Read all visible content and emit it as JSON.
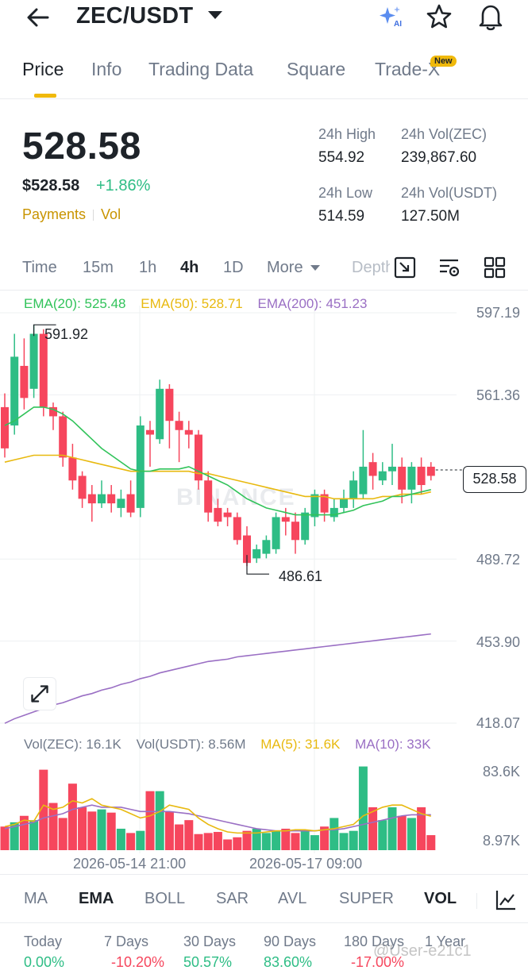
{
  "header": {
    "pair": "ZEC/USDT",
    "ai_label": "AI"
  },
  "tabs": [
    {
      "label": "Price"
    },
    {
      "label": "Info"
    },
    {
      "label": "Trading Data"
    },
    {
      "label": "Square"
    },
    {
      "label": "Trade-X"
    }
  ],
  "new_badge": "New",
  "summary": {
    "price": "528.58",
    "usd_price": "$528.58",
    "change": "+1.86%",
    "link_payments": "Payments",
    "link_vol": "Vol",
    "high_label": "24h High",
    "high_value": "554.92",
    "vol_zec_label": "24h Vol(ZEC)",
    "vol_zec_value": "239,867.60",
    "low_label": "24h Low",
    "low_value": "514.59",
    "vol_usdt_label": "24h Vol(USDT)",
    "vol_usdt_value": "127.50M"
  },
  "intervals": [
    {
      "label": "Time"
    },
    {
      "label": "15m"
    },
    {
      "label": "1h"
    },
    {
      "label": "4h"
    },
    {
      "label": "1D"
    },
    {
      "label": "More"
    },
    {
      "label": "Depth"
    }
  ],
  "ema_legend": {
    "ema20": "EMA(20): 525.48",
    "ema50": "EMA(50): 528.71",
    "ema200": "EMA(200): 451.23"
  },
  "colors": {
    "up": "#2ebd85",
    "down": "#f6465d",
    "ema20": "#31c35a",
    "ema50": "#e8b90f",
    "ema200": "#9a6fc4",
    "accent": "#f0b90b"
  },
  "price_axis": [
    "597.19",
    "561.36",
    "528.58",
    "489.72",
    "453.90",
    "418.07"
  ],
  "current_price_label": "528.58",
  "high_marker": "591.92",
  "low_marker": "486.61",
  "watermark": "BINANCE",
  "volume_legend": {
    "vol_zec": "Vol(ZEC): 16.1K",
    "vol_usdt": "Vol(USDT): 8.56M",
    "ma5": "MA(5): 31.6K",
    "ma10": "MA(10): 33K"
  },
  "volume_axis": [
    "83.6K",
    "8.97K"
  ],
  "date_labels": [
    "2026-05-14 21:00",
    "2026-05-17 09:00"
  ],
  "indicators": [
    {
      "label": "MA"
    },
    {
      "label": "EMA"
    },
    {
      "label": "BOLL"
    },
    {
      "label": "SAR"
    },
    {
      "label": "AVL"
    },
    {
      "label": "SUPER"
    },
    {
      "label": "VOL"
    }
  ],
  "performance": [
    {
      "label": "Today",
      "value": "0.00%"
    },
    {
      "label": "7 Days",
      "value": "-10.20%"
    },
    {
      "label": "30 Days",
      "value": "50.57%"
    },
    {
      "label": "90 Days",
      "value": "83.60%"
    },
    {
      "label": "180 Days",
      "value": "-17.00%"
    },
    {
      "label": "1 Year",
      "value": ""
    }
  ],
  "user_watermark": "@User-e21c1",
  "chart_data": {
    "type": "candlestick",
    "interval": "4h",
    "y_range": [
      418.07,
      597.19
    ],
    "candles": [
      {
        "o": 556,
        "h": 562,
        "c": 538,
        "l": 534
      },
      {
        "o": 548,
        "h": 588,
        "c": 578,
        "l": 544
      },
      {
        "o": 574,
        "h": 586,
        "c": 560,
        "l": 555
      },
      {
        "o": 564,
        "h": 591.92,
        "c": 588,
        "l": 560
      },
      {
        "o": 588,
        "h": 590,
        "c": 556,
        "l": 552
      },
      {
        "o": 556,
        "h": 558,
        "c": 552,
        "l": 546
      },
      {
        "o": 552,
        "h": 554,
        "c": 534,
        "l": 530
      },
      {
        "o": 534,
        "h": 540,
        "c": 524,
        "l": 520
      },
      {
        "o": 526,
        "h": 528,
        "c": 516,
        "l": 512
      },
      {
        "o": 518,
        "h": 522,
        "c": 514,
        "l": 506
      },
      {
        "o": 514,
        "h": 524,
        "c": 518,
        "l": 512
      },
      {
        "o": 518,
        "h": 522,
        "c": 514,
        "l": 510
      },
      {
        "o": 512,
        "h": 520,
        "c": 516,
        "l": 508
      },
      {
        "o": 518,
        "h": 524,
        "c": 510,
        "l": 508
      },
      {
        "o": 512,
        "h": 552,
        "c": 548,
        "l": 508
      },
      {
        "o": 546,
        "h": 550,
        "c": 544,
        "l": 530
      },
      {
        "o": 542,
        "h": 568,
        "c": 564,
        "l": 540
      },
      {
        "o": 564,
        "h": 566,
        "c": 550,
        "l": 538
      },
      {
        "o": 550,
        "h": 554,
        "c": 546,
        "l": 532
      },
      {
        "o": 546,
        "h": 550,
        "c": 544,
        "l": 538
      },
      {
        "o": 544,
        "h": 546,
        "c": 524,
        "l": 520
      },
      {
        "o": 524,
        "h": 528,
        "c": 510,
        "l": 506
      },
      {
        "o": 512,
        "h": 516,
        "c": 506,
        "l": 504
      },
      {
        "o": 510,
        "h": 512,
        "c": 508,
        "l": 504
      },
      {
        "o": 508,
        "h": 510,
        "c": 498,
        "l": 496
      },
      {
        "o": 500,
        "h": 504,
        "c": 488,
        "l": 486.61
      },
      {
        "o": 490,
        "h": 496,
        "c": 494,
        "l": 488
      },
      {
        "o": 492,
        "h": 500,
        "c": 498,
        "l": 490
      },
      {
        "o": 494,
        "h": 510,
        "c": 508,
        "l": 492
      },
      {
        "o": 508,
        "h": 512,
        "c": 506,
        "l": 500
      },
      {
        "o": 506,
        "h": 510,
        "c": 498,
        "l": 492
      },
      {
        "o": 498,
        "h": 512,
        "c": 510,
        "l": 496
      },
      {
        "o": 508,
        "h": 520,
        "c": 518,
        "l": 504
      },
      {
        "o": 518,
        "h": 520,
        "c": 510,
        "l": 506
      },
      {
        "o": 508,
        "h": 516,
        "c": 512,
        "l": 506
      },
      {
        "o": 512,
        "h": 520,
        "c": 516,
        "l": 510
      },
      {
        "o": 516,
        "h": 528,
        "c": 524,
        "l": 512
      },
      {
        "o": 518,
        "h": 546,
        "c": 530,
        "l": 516
      },
      {
        "o": 532,
        "h": 536,
        "c": 526,
        "l": 520
      },
      {
        "o": 524,
        "h": 532,
        "c": 528,
        "l": 522
      },
      {
        "o": 528,
        "h": 540,
        "c": 530,
        "l": 522
      },
      {
        "o": 530,
        "h": 534,
        "c": 520,
        "l": 514
      },
      {
        "o": 520,
        "h": 532,
        "c": 530,
        "l": 514
      },
      {
        "o": 530,
        "h": 534,
        "c": 522,
        "l": 518
      },
      {
        "o": 530,
        "h": 532,
        "c": 526,
        "l": 524
      }
    ],
    "ema20": [
      548,
      550,
      553,
      556,
      556,
      555,
      553,
      550,
      546,
      542,
      538,
      535,
      532,
      529,
      528,
      528,
      529,
      529,
      529,
      530,
      528,
      526,
      524,
      522,
      519,
      516,
      514,
      512,
      511,
      510,
      509,
      509,
      509,
      509,
      509,
      510,
      511,
      513,
      514,
      515,
      517,
      517,
      518,
      519,
      520
    ],
    "ema50": [
      532,
      533,
      534,
      535,
      535,
      535,
      535,
      534,
      533,
      532,
      531,
      530,
      529,
      528,
      528,
      528,
      528,
      528,
      528,
      528,
      527,
      527,
      526,
      525,
      524,
      523,
      522,
      521,
      520,
      519,
      518,
      517,
      517,
      517,
      516,
      516,
      516,
      516,
      516,
      517,
      517,
      518,
      518,
      518,
      519
    ],
    "ema200": [
      418,
      420,
      421.5,
      423,
      424.5,
      426,
      427,
      428.5,
      430,
      431,
      432.5,
      433.5,
      435,
      436,
      437.5,
      438.5,
      440,
      441,
      442,
      443,
      444,
      445,
      445.5,
      446,
      447,
      447.5,
      448,
      448.5,
      449,
      449.5,
      450,
      450.5,
      451,
      451.5,
      452,
      452.5,
      453,
      453.5,
      454,
      454.5,
      455,
      455.5,
      456,
      456.5,
      457
    ],
    "volume": [
      22,
      26,
      32,
      28,
      75,
      44,
      30,
      62,
      40,
      36,
      38,
      35,
      20,
      16,
      18,
      55,
      55,
      36,
      24,
      28,
      15,
      16,
      17,
      10,
      12,
      18,
      20,
      16,
      18,
      20,
      16,
      18,
      14,
      22,
      30,
      16,
      18,
      78,
      40,
      28,
      40,
      32,
      30,
      40,
      14
    ],
    "ma5": [
      22,
      24,
      28,
      27,
      42,
      38,
      40,
      46,
      44,
      48,
      42,
      40,
      38,
      34,
      30,
      32,
      36,
      42,
      40,
      38,
      30,
      24,
      20,
      17,
      16,
      16,
      16,
      17,
      18,
      18,
      19,
      19,
      18,
      19,
      20,
      22,
      24,
      32,
      36,
      40,
      42,
      42,
      38,
      34,
      31.6
    ],
    "ma10": [
      20,
      22,
      24,
      26,
      30,
      32,
      34,
      38,
      40,
      42,
      40,
      40,
      40,
      38,
      36,
      36,
      36,
      36,
      35,
      34,
      32,
      30,
      28,
      26,
      24,
      22,
      20,
      19,
      18,
      18,
      18,
      18,
      18,
      19,
      19,
      20,
      22,
      24,
      26,
      28,
      30,
      32,
      33,
      33,
      33
    ]
  }
}
